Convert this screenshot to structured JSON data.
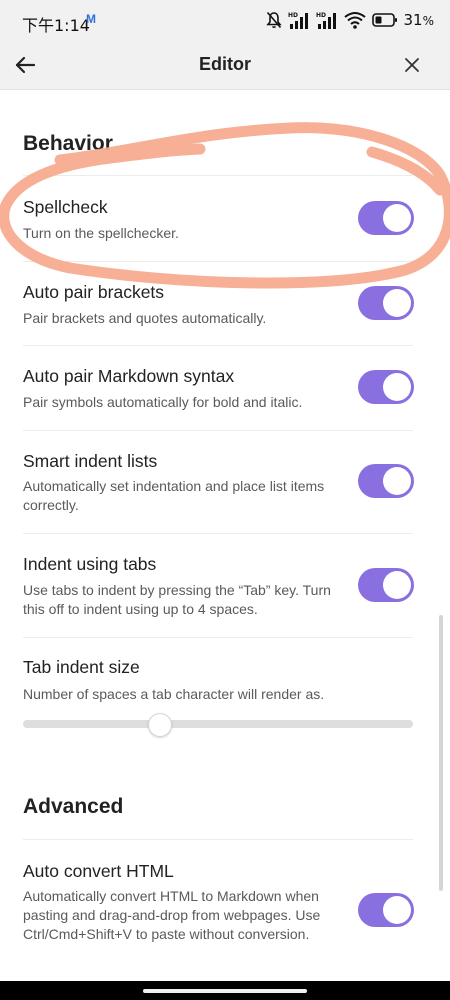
{
  "status_bar": {
    "time": "下午1:14",
    "mail_glyph": "M",
    "battery_percent": "31",
    "battery_unit": "%",
    "icons": [
      "bell-mute-icon",
      "hd-signal-icon",
      "hd-signal-icon",
      "wifi-icon",
      "battery-icon"
    ]
  },
  "header": {
    "title": "Editor",
    "back_icon": "arrow-left-icon",
    "close_icon": "close-icon"
  },
  "behavior": {
    "title": "Behavior",
    "items": [
      {
        "title": "Spellcheck",
        "description": "Turn on the spellchecker.",
        "enabled": true
      },
      {
        "title": "Auto pair brackets",
        "description": "Pair brackets and quotes automatically.",
        "enabled": true
      },
      {
        "title": "Auto pair Markdown syntax",
        "description": "Pair symbols automatically for bold and italic.",
        "enabled": true
      },
      {
        "title": "Smart indent lists",
        "description": "Automatically set indentation and place list items correctly.",
        "enabled": true
      },
      {
        "title": "Indent using tabs",
        "description": "Use tabs to indent by pressing the “Tab” key. Turn this off to indent using up to 4 spaces.",
        "enabled": true
      }
    ],
    "tab_indent": {
      "title": "Tab indent size",
      "description": "Number of spaces a tab character will render as.",
      "slider_fraction": 0.35
    }
  },
  "advanced": {
    "title": "Advanced",
    "items": [
      {
        "title": "Auto convert HTML",
        "description": "Automatically convert HTML to Markdown when pasting and drag-and-drop from webpages. Use Ctrl/Cmd+Shift+V to paste without conversion.",
        "enabled": true
      }
    ]
  },
  "colors": {
    "toggle_on": "#8a6fe0",
    "annotation_stroke": "#f6a98c"
  }
}
